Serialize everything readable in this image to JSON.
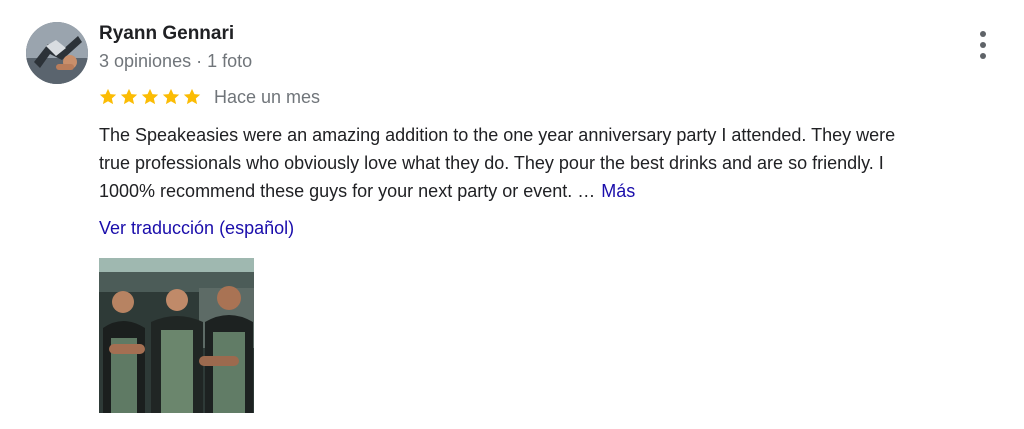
{
  "review": {
    "reviewer_name": "Ryann Gennari",
    "reviewer_meta": "3 opiniones · 1 foto",
    "rating": 5,
    "rating_max": 5,
    "star_color": "#fbbc04",
    "date": "Hace un mes",
    "text_lines": [
      "The Speakeasies were an amazing addition to the one year anniversary party I attended.  They were",
      "true professionals who obviously love what they do. They pour the best drinks and are so friendly. I",
      "1000% recommend these guys for your next party or event. …"
    ],
    "more_label": "Más",
    "translate_label": "Ver traducción (español)",
    "link_color": "#1a0dab",
    "more_options_icon": "more-vert-icon"
  }
}
